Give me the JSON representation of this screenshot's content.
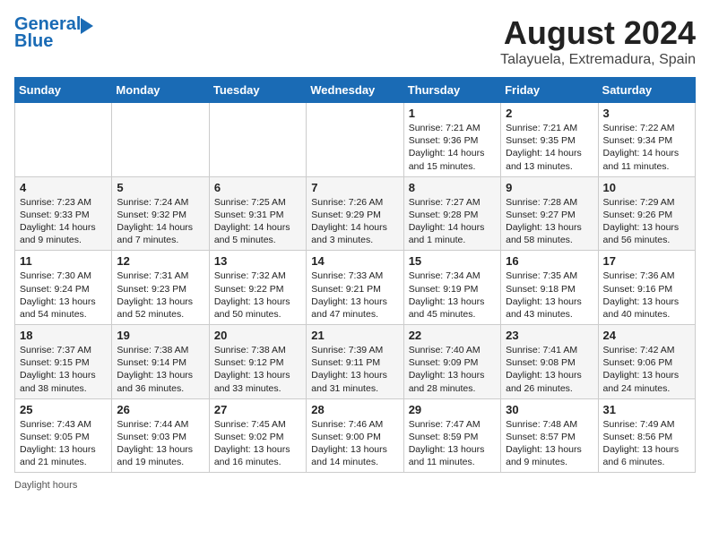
{
  "header": {
    "logo_line1": "General",
    "logo_line2": "Blue",
    "month": "August 2024",
    "location": "Talayuela, Extremadura, Spain"
  },
  "days_of_week": [
    "Sunday",
    "Monday",
    "Tuesday",
    "Wednesday",
    "Thursday",
    "Friday",
    "Saturday"
  ],
  "weeks": [
    [
      {
        "day": "",
        "info": ""
      },
      {
        "day": "",
        "info": ""
      },
      {
        "day": "",
        "info": ""
      },
      {
        "day": "",
        "info": ""
      },
      {
        "day": "1",
        "info": "Sunrise: 7:21 AM\nSunset: 9:36 PM\nDaylight: 14 hours and 15 minutes."
      },
      {
        "day": "2",
        "info": "Sunrise: 7:21 AM\nSunset: 9:35 PM\nDaylight: 14 hours and 13 minutes."
      },
      {
        "day": "3",
        "info": "Sunrise: 7:22 AM\nSunset: 9:34 PM\nDaylight: 14 hours and 11 minutes."
      }
    ],
    [
      {
        "day": "4",
        "info": "Sunrise: 7:23 AM\nSunset: 9:33 PM\nDaylight: 14 hours and 9 minutes."
      },
      {
        "day": "5",
        "info": "Sunrise: 7:24 AM\nSunset: 9:32 PM\nDaylight: 14 hours and 7 minutes."
      },
      {
        "day": "6",
        "info": "Sunrise: 7:25 AM\nSunset: 9:31 PM\nDaylight: 14 hours and 5 minutes."
      },
      {
        "day": "7",
        "info": "Sunrise: 7:26 AM\nSunset: 9:29 PM\nDaylight: 14 hours and 3 minutes."
      },
      {
        "day": "8",
        "info": "Sunrise: 7:27 AM\nSunset: 9:28 PM\nDaylight: 14 hours and 1 minute."
      },
      {
        "day": "9",
        "info": "Sunrise: 7:28 AM\nSunset: 9:27 PM\nDaylight: 13 hours and 58 minutes."
      },
      {
        "day": "10",
        "info": "Sunrise: 7:29 AM\nSunset: 9:26 PM\nDaylight: 13 hours and 56 minutes."
      }
    ],
    [
      {
        "day": "11",
        "info": "Sunrise: 7:30 AM\nSunset: 9:24 PM\nDaylight: 13 hours and 54 minutes."
      },
      {
        "day": "12",
        "info": "Sunrise: 7:31 AM\nSunset: 9:23 PM\nDaylight: 13 hours and 52 minutes."
      },
      {
        "day": "13",
        "info": "Sunrise: 7:32 AM\nSunset: 9:22 PM\nDaylight: 13 hours and 50 minutes."
      },
      {
        "day": "14",
        "info": "Sunrise: 7:33 AM\nSunset: 9:21 PM\nDaylight: 13 hours and 47 minutes."
      },
      {
        "day": "15",
        "info": "Sunrise: 7:34 AM\nSunset: 9:19 PM\nDaylight: 13 hours and 45 minutes."
      },
      {
        "day": "16",
        "info": "Sunrise: 7:35 AM\nSunset: 9:18 PM\nDaylight: 13 hours and 43 minutes."
      },
      {
        "day": "17",
        "info": "Sunrise: 7:36 AM\nSunset: 9:16 PM\nDaylight: 13 hours and 40 minutes."
      }
    ],
    [
      {
        "day": "18",
        "info": "Sunrise: 7:37 AM\nSunset: 9:15 PM\nDaylight: 13 hours and 38 minutes."
      },
      {
        "day": "19",
        "info": "Sunrise: 7:38 AM\nSunset: 9:14 PM\nDaylight: 13 hours and 36 minutes."
      },
      {
        "day": "20",
        "info": "Sunrise: 7:38 AM\nSunset: 9:12 PM\nDaylight: 13 hours and 33 minutes."
      },
      {
        "day": "21",
        "info": "Sunrise: 7:39 AM\nSunset: 9:11 PM\nDaylight: 13 hours and 31 minutes."
      },
      {
        "day": "22",
        "info": "Sunrise: 7:40 AM\nSunset: 9:09 PM\nDaylight: 13 hours and 28 minutes."
      },
      {
        "day": "23",
        "info": "Sunrise: 7:41 AM\nSunset: 9:08 PM\nDaylight: 13 hours and 26 minutes."
      },
      {
        "day": "24",
        "info": "Sunrise: 7:42 AM\nSunset: 9:06 PM\nDaylight: 13 hours and 24 minutes."
      }
    ],
    [
      {
        "day": "25",
        "info": "Sunrise: 7:43 AM\nSunset: 9:05 PM\nDaylight: 13 hours and 21 minutes."
      },
      {
        "day": "26",
        "info": "Sunrise: 7:44 AM\nSunset: 9:03 PM\nDaylight: 13 hours and 19 minutes."
      },
      {
        "day": "27",
        "info": "Sunrise: 7:45 AM\nSunset: 9:02 PM\nDaylight: 13 hours and 16 minutes."
      },
      {
        "day": "28",
        "info": "Sunrise: 7:46 AM\nSunset: 9:00 PM\nDaylight: 13 hours and 14 minutes."
      },
      {
        "day": "29",
        "info": "Sunrise: 7:47 AM\nSunset: 8:59 PM\nDaylight: 13 hours and 11 minutes."
      },
      {
        "day": "30",
        "info": "Sunrise: 7:48 AM\nSunset: 8:57 PM\nDaylight: 13 hours and 9 minutes."
      },
      {
        "day": "31",
        "info": "Sunrise: 7:49 AM\nSunset: 8:56 PM\nDaylight: 13 hours and 6 minutes."
      }
    ]
  ],
  "footer": {
    "daylight_label": "Daylight hours"
  }
}
